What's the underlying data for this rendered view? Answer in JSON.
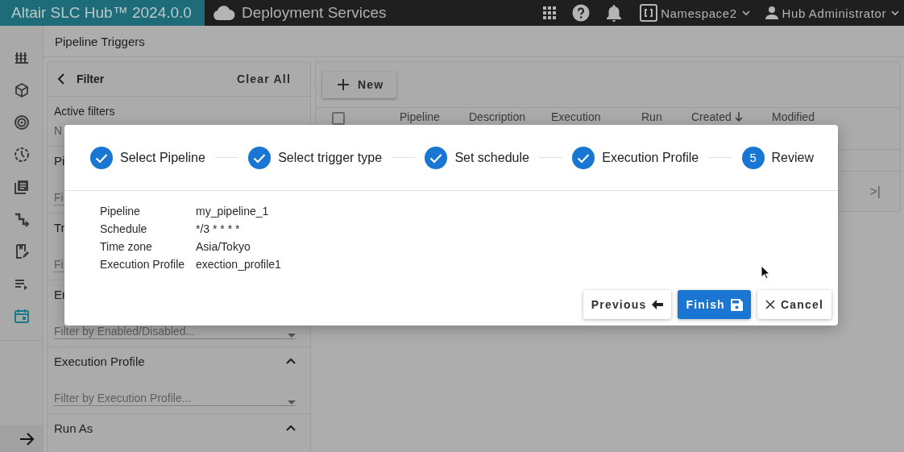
{
  "top_bar": {
    "product": "Altair SLC Hub™ 2024.0.0",
    "app": "Deployment Services",
    "namespace": "Namespace2",
    "user": "Hub Administrator"
  },
  "sidebar": {
    "items": [
      {
        "selected": false
      },
      {
        "selected": false
      },
      {
        "selected": false
      },
      {
        "selected": false
      },
      {
        "selected": false
      },
      {
        "selected": false
      },
      {
        "selected": false
      },
      {
        "selected": false
      },
      {
        "selected": true
      }
    ]
  },
  "page_title": "Pipeline Triggers",
  "filter": {
    "title": "Filter",
    "clear": "Clear All",
    "active_label": "Active filters",
    "active_value": "N",
    "sections": [
      {
        "title": "Pi",
        "placeholder": "Fi"
      },
      {
        "title": "Tr",
        "placeholder": "Fi"
      },
      {
        "title": "Er",
        "placeholder": "Filter by Enabled/Disabled...",
        "dropdown": true
      },
      {
        "title": "Execution Profile",
        "expanded": true,
        "placeholder": "Filter by Execution Profile...",
        "dropdown": true
      },
      {
        "title": "Run As",
        "expanded": true
      }
    ]
  },
  "triggers": {
    "new_button": "New",
    "select_all_checked": false,
    "columns": [
      {
        "label": "Pipeline",
        "sorted": false
      },
      {
        "label": "Description",
        "sorted": false
      },
      {
        "label": "Execution",
        "sorted": false
      },
      {
        "label": "Run",
        "sorted": false
      },
      {
        "label": "Created",
        "sorted": true
      },
      {
        "label": "Modified",
        "sorted": false
      }
    ],
    "pager_last": ">|"
  },
  "dialog": {
    "steps": [
      {
        "label": "Select Pipeline",
        "completed": true
      },
      {
        "label": "Select trigger type",
        "completed": true
      },
      {
        "label": "Set schedule",
        "completed": true
      },
      {
        "label": "Execution Profile",
        "completed": true
      },
      {
        "label": "Review",
        "completed": false,
        "number": "5"
      }
    ],
    "review": [
      {
        "label": "Pipeline",
        "value": "my_pipeline_1"
      },
      {
        "label": "Schedule",
        "value": "*/3 * * * *"
      },
      {
        "label": "Time zone",
        "value": "Asia/Tokyo"
      },
      {
        "label": "Execution Profile",
        "value": "exection_profile1"
      }
    ],
    "buttons": [
      {
        "kind": "previous",
        "label": "Previous"
      },
      {
        "kind": "finish",
        "label": "Finish"
      },
      {
        "kind": "cancel",
        "label": "Cancel"
      }
    ]
  }
}
